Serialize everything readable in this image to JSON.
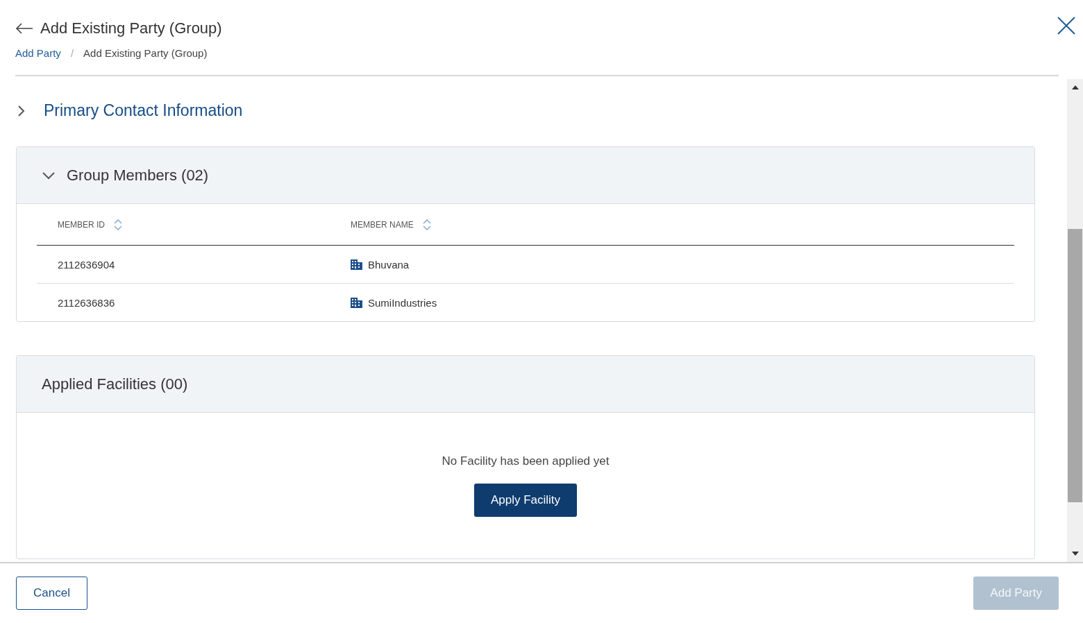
{
  "header": {
    "title": "Add Existing Party (Group)",
    "breadcrumb_separator": "/",
    "breadcrumbs": [
      {
        "label": "Add Party",
        "link": true
      },
      {
        "label": "Add Existing Party (Group)",
        "link": false
      }
    ]
  },
  "primary_contact": {
    "title": "Primary Contact Information",
    "expanded": false
  },
  "group_members": {
    "title": "Group Members (02)",
    "expanded": true,
    "columns": [
      "MEMBER ID",
      "MEMBER NAME"
    ],
    "rows": [
      {
        "member_id": "2112636904",
        "member_name": "Bhuvana"
      },
      {
        "member_id": "2112636836",
        "member_name": "SumiIndustries"
      }
    ]
  },
  "applied_facilities": {
    "title": "Applied Facilities (00)",
    "empty_message": "No Facility has been applied yet",
    "button": "Apply Facility"
  },
  "footer": {
    "cancel": "Cancel",
    "submit": {
      "label": "Add Party",
      "disabled": true
    }
  }
}
